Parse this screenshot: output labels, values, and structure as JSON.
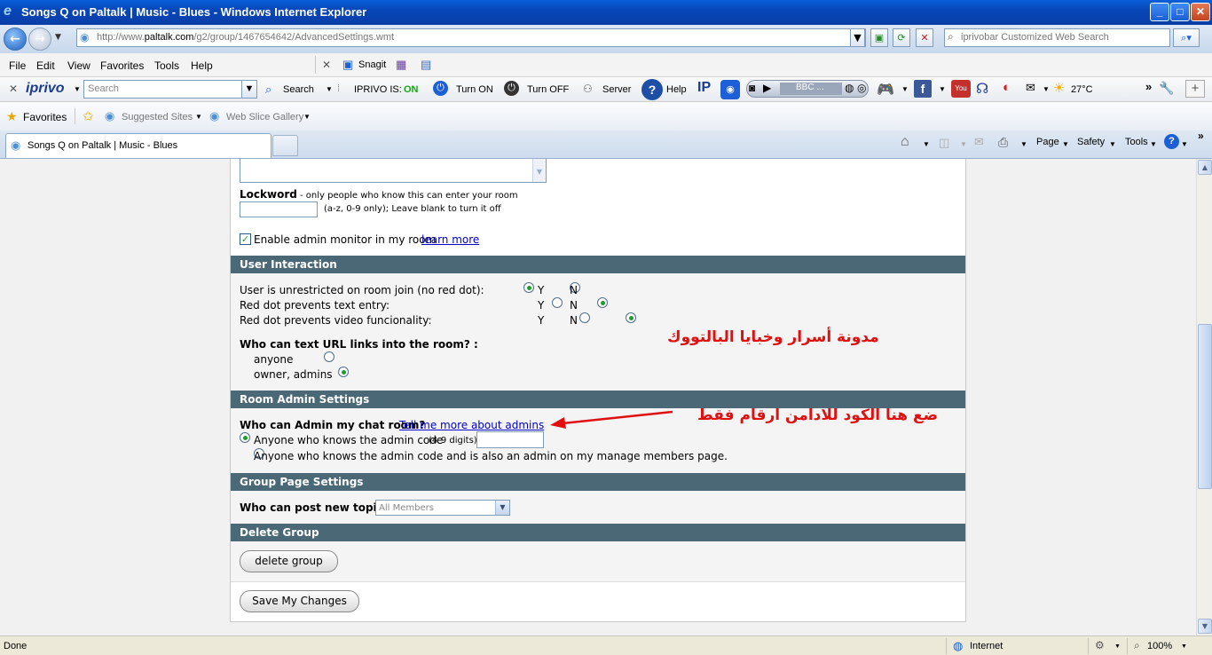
{
  "window": {
    "title": "Songs Q on Paltalk | Music - Blues - Windows Internet Explorer",
    "min": "_",
    "max": "□",
    "close": "✕"
  },
  "address": {
    "url_prefix": "http://www.",
    "url_domain": "paltalk.com",
    "url_path": "/g2/group/1467654642/AdvancedSettings.wmt",
    "search_placeholder": "iprivobar Customized Web Search"
  },
  "menu": [
    "File",
    "Edit",
    "View",
    "Favorites",
    "Tools",
    "Help"
  ],
  "menu_tools": {
    "snagit": "Snagit"
  },
  "iprivo": {
    "logo": "iprivo",
    "search_placeholder": "Search",
    "search_btn": "Search",
    "status_label": "IPRIVO IS:",
    "status_value": "ON",
    "turn_on": "Turn ON",
    "turn_off": "Turn OFF",
    "server": "Server",
    "help": "Help",
    "radio_station": "BBC ...",
    "temperature": "27°C"
  },
  "favorites": {
    "label": "Favorites",
    "suggested": "Suggested Sites",
    "gallery": "Web Slice Gallery"
  },
  "tab": {
    "title": "Songs Q on Paltalk | Music - Blues"
  },
  "cmdbar": {
    "page": "Page",
    "safety": "Safety",
    "tools": "Tools"
  },
  "settings": {
    "lockword_label": "Lockword",
    "lockword_desc": " - only people who know this can enter your room",
    "lockword_hint": "(a-z, 0-9 only); Leave blank to turn it off",
    "admin_monitor": "Enable admin monitor in my room",
    "learn_more": "learn more",
    "user_interaction": {
      "heading": "User Interaction",
      "rows": [
        {
          "label": "User is unrestricted on room join (no red dot):",
          "y": "Y",
          "n": "N"
        },
        {
          "label": "Red dot prevents text entry:",
          "y": "Y",
          "n": "N"
        },
        {
          "label": "Red dot prevents video funcionality:",
          "y": "Y",
          "n": "N"
        }
      ],
      "url_question": "Who can text URL links into the room? :",
      "opt_anyone": "anyone",
      "opt_owner": "owner, admins"
    },
    "room_admin": {
      "heading": "Room Admin Settings",
      "question": "Who can Admin my chat room?",
      "tell_more": "Tell me more about admins",
      "opt1": "Anyone who knows the admin code",
      "opt1_hint": "(4-9 digits)",
      "opt2": "Anyone who knows the admin code and is also an admin on my manage members page."
    },
    "group_page": {
      "heading": "Group Page Settings",
      "question": "Who can post new topics?",
      "selected": "All Members"
    },
    "delete_group": {
      "heading": "Delete Group",
      "button": "delete group"
    },
    "save": "Save My Changes"
  },
  "annotations": {
    "blog": "مدونة أسرار وخبايا البالتووك",
    "instruction": "ضع هنا الكود للادامن ارقام فقط"
  },
  "status": {
    "left": "Done",
    "zone": "Internet",
    "zoom": "100%"
  },
  "colors": {
    "section_header": "#4b6877",
    "radio_selected": "#1e9d2a",
    "annotation": "#e01010",
    "link": "#0000cc"
  }
}
